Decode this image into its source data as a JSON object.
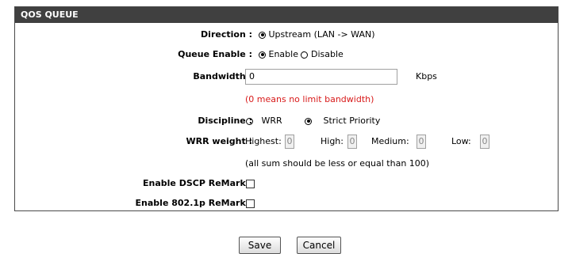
{
  "panel": {
    "title": "QOS QUEUE"
  },
  "direction": {
    "label": "Direction :",
    "option": "Upstream (LAN -> WAN)",
    "selected": true
  },
  "queue_enable": {
    "label": "Queue Enable :",
    "enable_label": "Enable",
    "disable_label": "Disable",
    "selected": "Enable"
  },
  "bandwidth": {
    "label": "Bandwidth :",
    "value": "0",
    "unit": "Kbps",
    "hint": "(0 means no limit bandwidth)"
  },
  "discipline": {
    "label": "Discipline :",
    "wrr_label": "WRR",
    "strict_label": "Strict Priority",
    "selected": "Strict Priority"
  },
  "wrr_weight": {
    "label": "WRR weight :",
    "highest_label": "Highest:",
    "highest_value": "0",
    "high_label": "High:",
    "high_value": "0",
    "medium_label": "Medium:",
    "medium_value": "0",
    "low_label": "Low:",
    "low_value": "0",
    "note": "(all sum should be less or equal than 100)"
  },
  "dscp_remark": {
    "label": "Enable DSCP ReMark :",
    "checked": false
  },
  "dot1p_remark": {
    "label": "Enable 802.1p ReMark :",
    "checked": false
  },
  "buttons": {
    "save": "Save",
    "cancel": "Cancel"
  },
  "colors": {
    "header_bg": "#404040",
    "hint_red": "#d81a1a"
  }
}
